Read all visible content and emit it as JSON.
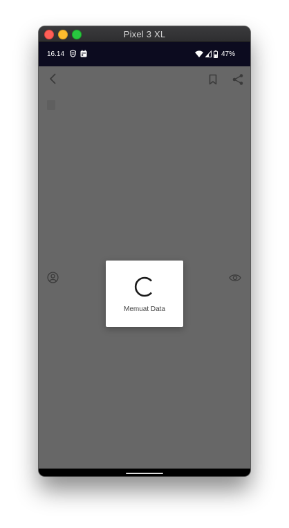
{
  "window": {
    "title": "Pixel 3 XL",
    "traffic_light_colors": [
      "#ff5f57",
      "#febc2e",
      "#28c840"
    ]
  },
  "status_bar": {
    "time": "16.14",
    "battery_percent": "47%",
    "left_icons": [
      "shield-notification-icon",
      "calendar-notification-icon"
    ],
    "right_icons": [
      "wifi-icon",
      "signal-icon",
      "battery-icon"
    ]
  },
  "toolbar": {
    "icons": [
      "back-arrow-icon",
      "bookmark-icon",
      "share-icon"
    ]
  },
  "content": {
    "icons": [
      "author-icon",
      "eye-icon"
    ]
  },
  "loading_dialog": {
    "message": "Memuat Data",
    "icon": "loading-spinner-icon"
  },
  "colors": {
    "screen_overlay": "#676767",
    "status_bar": "#0c0b1f",
    "dialog_bg": "#ffffff"
  }
}
